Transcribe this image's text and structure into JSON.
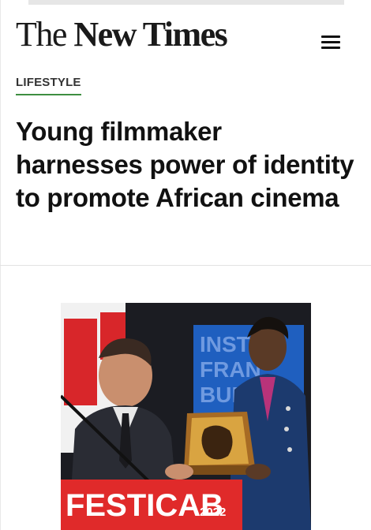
{
  "header": {
    "logo_the": "The",
    "logo_rest": " New Times"
  },
  "article": {
    "category": "LIFESTYLE",
    "headline": "Young filmmaker harnesses power of identity to promote African cinema"
  },
  "photo": {
    "background_text_lines": [
      "INST",
      "FRAN",
      "BUR"
    ],
    "trophy_banner": "FESTICAB",
    "trophy_year": "2022"
  },
  "colors": {
    "category_underline": "#3e8e41",
    "banner_red": "#e02a2a",
    "backdrop_blue": "#1f5fbf"
  }
}
